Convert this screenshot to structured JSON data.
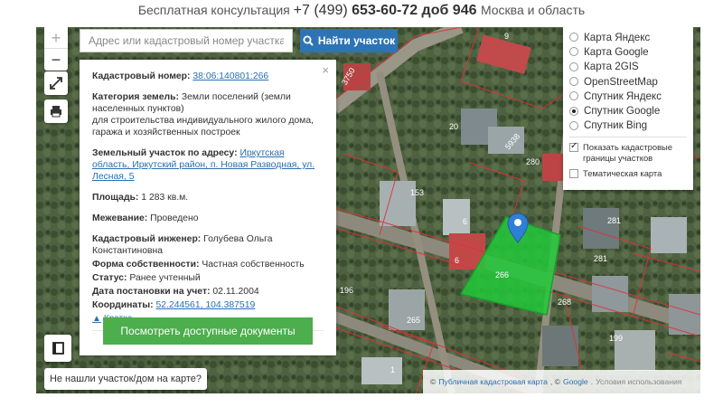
{
  "header": {
    "consult": "Бесплатная консультация",
    "phone_prefix": "+7 (499) ",
    "phone_main": "653-60-72 доб 946",
    "region": "Москва и область"
  },
  "search": {
    "placeholder": "Адрес или кадастровый номер участка",
    "button": "Найти участок"
  },
  "parcel": {
    "cadastral_label": "Кадастровый номер:",
    "cadastral_value": "38:06:140801:266",
    "category_label": "Категория земель:",
    "category_value": "Земли поселений (земли населенных пунктов)",
    "use_value": "для строительства индивидуального жилого дома, гаража и хозяйственных построек",
    "address_label": "Земельный участок по адресу:",
    "address_value": "Иркутская область, Иркутский район, п. Новая Разводная, ул. Лесная, 5",
    "area_label": "Площадь:",
    "area_value": "1 283 кв.м.",
    "survey_label": "Межевание:",
    "survey_value": "Проведено",
    "engineer_label": "Кадастровый инженер:",
    "engineer_value": "Голубева Ольга Константиновна",
    "ownership_label": "Форма собственности:",
    "ownership_value": "Частная собственность",
    "status_label": "Статус:",
    "status_value": "Ранее учтенный",
    "date_label": "Дата постановки на учет:",
    "date_value": "02.11.2004",
    "coords_label": "Координаты:",
    "coords_value": "52.244561, 104.387519",
    "collapse": "Кратко",
    "docs_button": "Посмотреть доступные документы",
    "close": "×"
  },
  "layers": {
    "options": [
      {
        "label": "Карта Яндекс",
        "selected": false
      },
      {
        "label": "Карта Google",
        "selected": false
      },
      {
        "label": "Карта 2GIS",
        "selected": false
      },
      {
        "label": "OpenStreetMap",
        "selected": false
      },
      {
        "label": "Спутник Яндекс",
        "selected": false
      },
      {
        "label": "Спутник Google",
        "selected": true
      },
      {
        "label": "Спутник Bing",
        "selected": false
      }
    ],
    "show_borders": "Показать кадастровые границы участков",
    "thematic": "Тематическая карта"
  },
  "controls": {
    "zoom_in": "+",
    "zoom_out": "−",
    "not_found": "Не нашли участок/дом на карте?"
  },
  "attribution": {
    "copy": "©",
    "pkk": "Публичная кадастровая карта",
    "sep": ", ©",
    "google": "Google",
    "dot": ".",
    "terms": "Условия использования"
  },
  "map_labels": {
    "l9": "9",
    "l3750": "3750",
    "l20": "20",
    "l5938": "5938",
    "l280": "280",
    "l153": "153",
    "l6a": "6",
    "l6b": "6",
    "l266": "266",
    "l281a": "281",
    "l281b": "281",
    "l268": "268",
    "l196": "196",
    "l265": "265",
    "l199": "199",
    "l1": "1"
  },
  "colors": {
    "parcel_fill": "#22c93a",
    "marker": "#2f7fd6",
    "search_button": "#2e74b5",
    "docs_button": "#4cae4c",
    "cadastral_border": "#e0303a"
  }
}
